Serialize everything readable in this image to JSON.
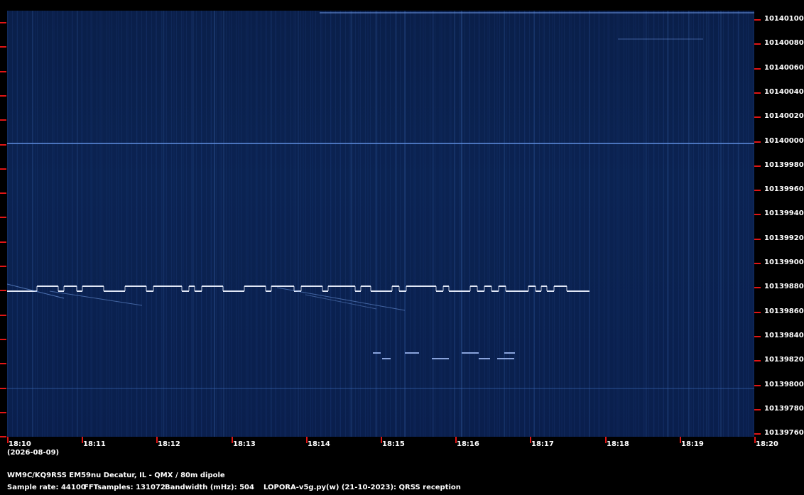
{
  "spectrogram": {
    "y_ticks": [
      "10140100",
      "10140080",
      "10140060",
      "10140040",
      "10140020",
      "10140000",
      "10139980",
      "10139960",
      "10139940",
      "10139920",
      "10139900",
      "10139880",
      "10139860",
      "10139840",
      "10139820",
      "10139800",
      "10139780",
      "10139760"
    ],
    "x_ticks": [
      "18:10",
      "18:11",
      "18:12",
      "18:13",
      "18:14",
      "18:15",
      "18:16",
      "18:17",
      "18:18",
      "18:19",
      "18:20"
    ],
    "date_label": "(2026-08-09)",
    "colors": {
      "background": "#0a1f4a",
      "signal": "#dfe9ff",
      "tick": "#e01515"
    }
  },
  "footer": {
    "station": "WM9C/KQ9RSS EM59nu Decatur, IL - QMX / 80m dipole",
    "sample_rate": "Sample rate: 44100",
    "fft_samples": "FFTsamples: 131072",
    "bandwidth": "Bandwidth (mHz): 504",
    "software": "LOPORA-v5g.py(w) (21-10-2023): QRSS reception"
  }
}
